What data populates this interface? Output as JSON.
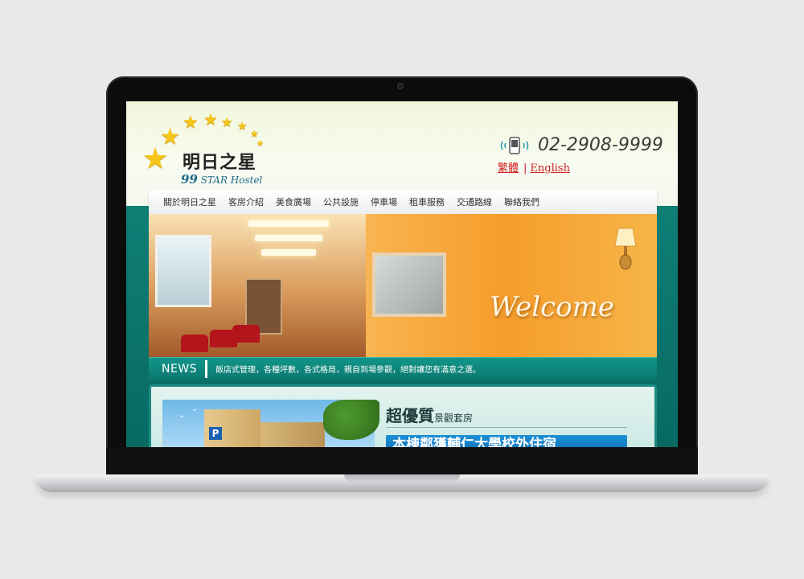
{
  "site": {
    "logo": {
      "name_cn": "明日之星",
      "name_en_num": "99",
      "name_en_text": "STAR Hostel"
    },
    "phone": "02-2908-9999",
    "languages": {
      "traditional": "繁體",
      "separator": "|",
      "english": "English"
    },
    "nav": [
      "關於明日之星",
      "客房介紹",
      "美食廣場",
      "公共設施",
      "停車場",
      "租車服務",
      "交通路線",
      "聯絡我們"
    ],
    "banner": {
      "welcome": "Welcome"
    },
    "news": {
      "label": "NEWS",
      "text": "飯店式管理，各種坪數，各式格局，親自到場參觀，絕對讓您有滿意之選。"
    },
    "feature": {
      "title_big": "超優質",
      "title_small": "景觀套房",
      "strip_text": "本棟鄰獲輔仁大學校外住宿"
    }
  },
  "colors": {
    "teal": "#0f7f76",
    "accent_red": "#d02020",
    "star_gold": "#f7c61b"
  }
}
